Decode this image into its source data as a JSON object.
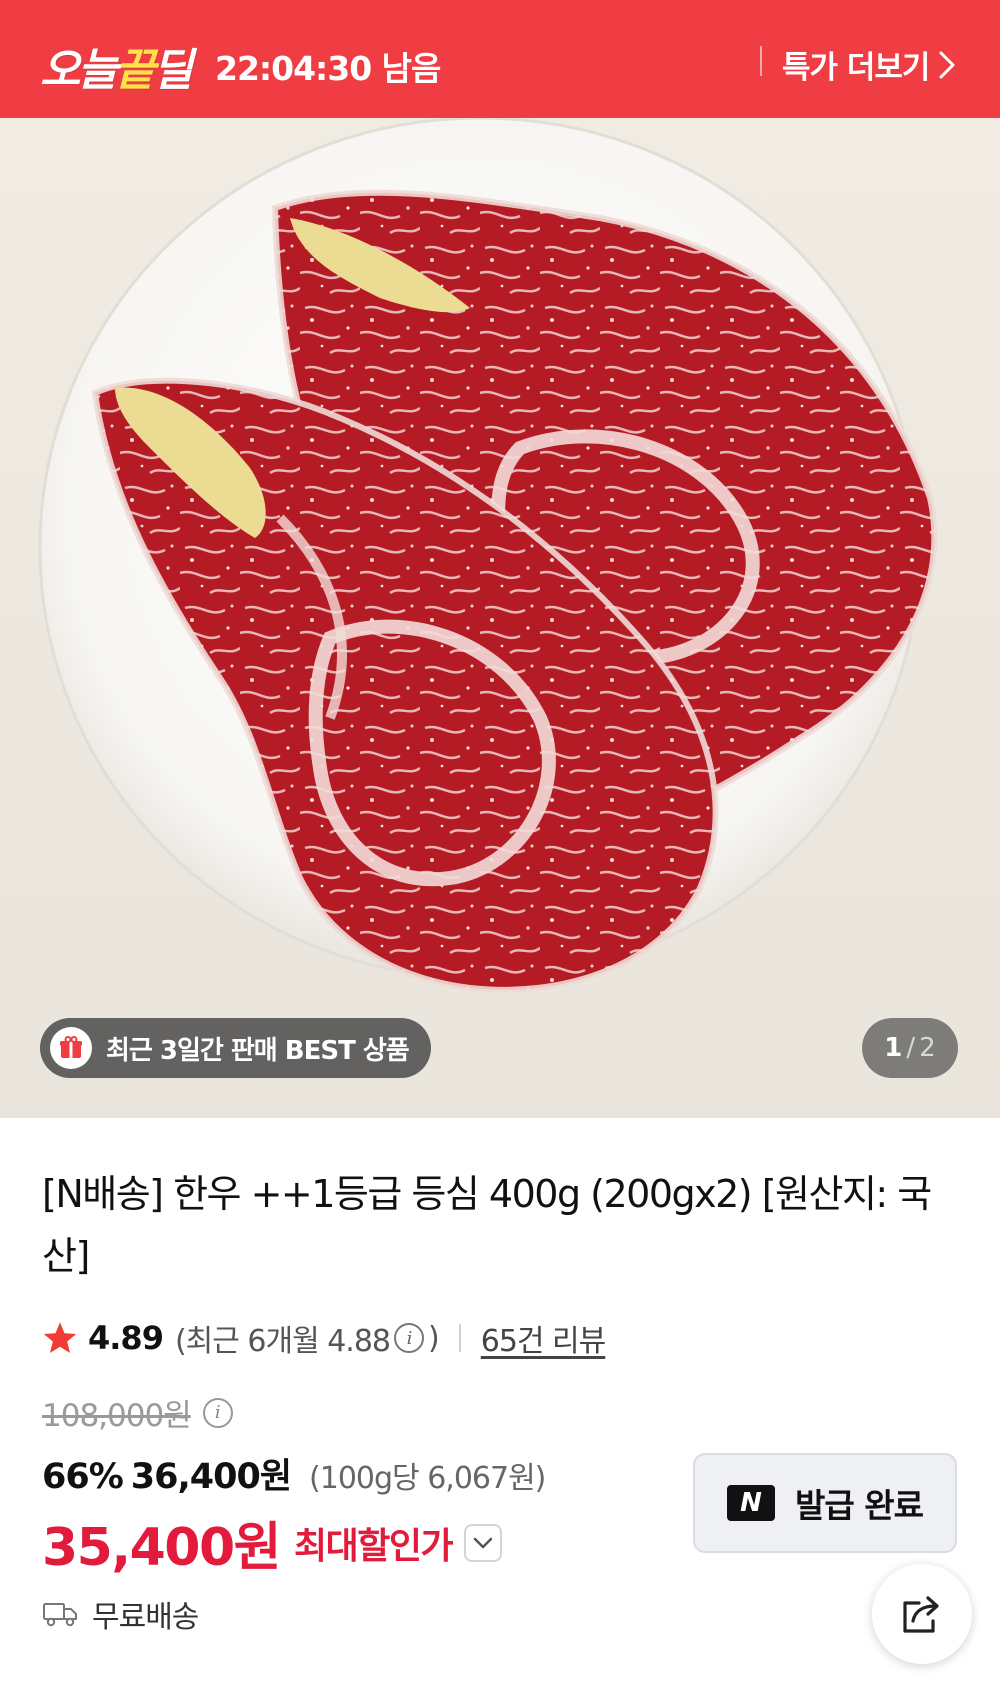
{
  "banner": {
    "brand_part1": "오늘",
    "brand_highlight": "끝",
    "brand_part2": "딜",
    "timer": "22:04:30 남음",
    "more_label": "특가 더보기"
  },
  "hero": {
    "badge_text": "최근 3일간 판매 BEST 상품",
    "page_current": "1",
    "page_sep": "/",
    "page_total": "2"
  },
  "product": {
    "title": "[N배송] 한우 ++1등급 등심 400g (200gx2) [원산지: 국산]",
    "rating": "4.89",
    "recent_prefix": "(최근 6개월 4.88",
    "recent_suffix": ")",
    "reviews": "65건 리뷰",
    "original_price": "108,000원",
    "discount_pct": "66%",
    "sale_price": "36,400원",
    "unit_price": "(100g당 6,067원)",
    "final_price": "35,400원",
    "final_label": "최대할인가",
    "coupon_logo": "N",
    "coupon_label": "발급 완료",
    "shipping": "무료배송"
  },
  "colors": {
    "banner_red": "#ef3d43",
    "brand_yellow": "#ffe14a",
    "price_red": "#e21b3c",
    "star": "#f03c32"
  },
  "icons": [
    "chevron-right-icon",
    "gift-icon",
    "star-icon",
    "info-icon",
    "chevron-down-icon",
    "truck-icon",
    "share-icon"
  ]
}
